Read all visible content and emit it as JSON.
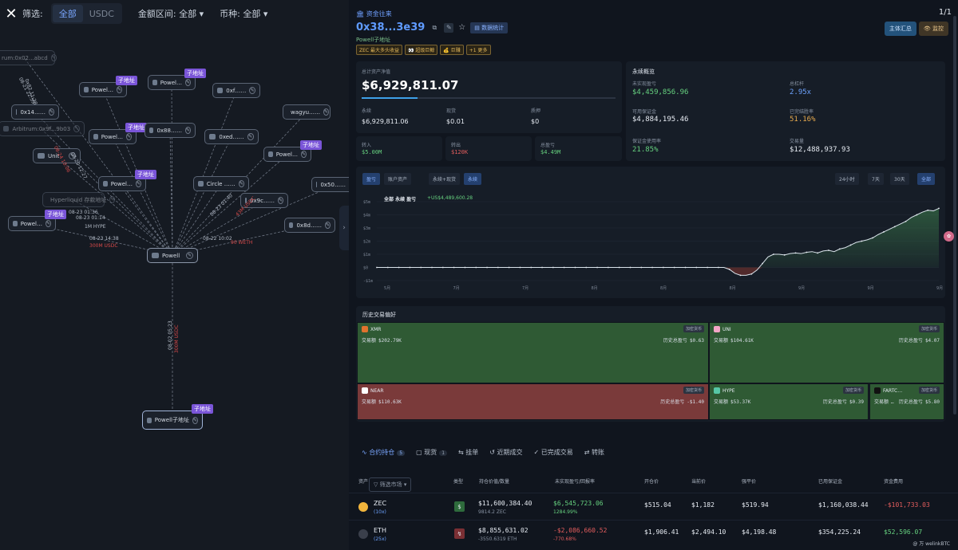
{
  "filterbar": {
    "filter_label": "筛选:",
    "seg_all": "全部",
    "seg_usdc": "USDC",
    "amount_label": "金额区间: 全部 ▾",
    "coin_label": "币种: 全部 ▾",
    "close": "✕"
  },
  "graph": {
    "nodes": [
      {
        "id": "n-arb-top",
        "label": "rum:0x02...abcd",
        "faint": true
      },
      {
        "id": "n-powell-a",
        "label": "Powel…"
      },
      {
        "id": "n-powell-b",
        "label": "Powel…"
      },
      {
        "id": "n-0xf",
        "label": "0xf……"
      },
      {
        "id": "n-0x14",
        "label": "0x14……"
      },
      {
        "id": "n-wagyu",
        "label": "wagyu……"
      },
      {
        "id": "n-arbitrum",
        "label": "Arbitrum:0x9f...9b03",
        "faint": true
      },
      {
        "id": "n-powell-c",
        "label": "Powel…"
      },
      {
        "id": "n-0x88",
        "label": "0x88……"
      },
      {
        "id": "n-0xed",
        "label": "0xed……"
      },
      {
        "id": "n-powell-d",
        "label": "Powel…"
      },
      {
        "id": "n-unit",
        "label": "Unit"
      },
      {
        "id": "n-powell-e",
        "label": "Powel…"
      },
      {
        "id": "n-circle",
        "label": "Circle ……"
      },
      {
        "id": "n-0x50",
        "label": "0x50……"
      },
      {
        "id": "n-hyperliquid",
        "label": "Hyperliquid 存款地址",
        "faint": true
      },
      {
        "id": "n-0x9c",
        "label": "0x9c……"
      },
      {
        "id": "n-powell-f",
        "label": "Powel…"
      },
      {
        "id": "n-0x8d",
        "label": "0x8d……"
      },
      {
        "id": "n-powell-center",
        "label": "Powell"
      },
      {
        "id": "n-powell-sub",
        "label": "Powell子地址"
      }
    ],
    "subaddr_tag": "子地址",
    "edge_labels": [
      {
        "t": "08-21 22:59",
        "red": false
      },
      {
        "t": "0x82 11:28",
        "red": false
      },
      {
        "t": "08-24 10:06",
        "red": true
      },
      {
        "t": "08-20 12:27",
        "red": false
      },
      {
        "t": "08-23 01:36",
        "red": false
      },
      {
        "t": "08-23 01:14",
        "red": false
      },
      {
        "t": "1M HYPE",
        "red": false
      },
      {
        "t": "08-23 14:38",
        "red": false
      },
      {
        "t": "300M USDC",
        "red": true
      },
      {
        "t": "08-22 10:02",
        "red": false
      },
      {
        "t": "90 WETH",
        "red": true
      },
      {
        "t": "08-23 01:40",
        "red": false
      },
      {
        "t": "43M USDC",
        "red": true
      },
      {
        "t": "08-02 05:23",
        "red": false
      },
      {
        "t": "300M USDC",
        "red": true
      }
    ],
    "collapse": "›"
  },
  "header": {
    "breadcrumb": "🏛 资金往来",
    "address": "0x38...3e39",
    "copy_icon": "⧉",
    "edit_icon": "✎",
    "star": "☆",
    "stats_btn": "▤ 数据统计",
    "subname": "Powell子地址",
    "tags": [
      "ZEC 最大多头收益",
      "👀 超级巨鲸",
      "💰 巨赚",
      "+1 更多"
    ],
    "pager": "1/1",
    "btn_summary": "主体汇总",
    "btn_monitor": "👁 监控"
  },
  "balance": {
    "label": "总计资产净值",
    "value": "$6,929,811.07",
    "perp_label": "永续",
    "perp_value": "$6,929,811.06",
    "spot_label": "现货",
    "spot_value": "$0.01",
    "stake_label": "质押",
    "stake_value": "$0",
    "in_label": "转入",
    "in_value": "$5.00M",
    "out_label": "转出",
    "out_value": "$120K",
    "total_label": "总盈亏",
    "total_value": "$4.49M",
    "bar_fraction": 0.22
  },
  "perp": {
    "title": "永续概览",
    "upnl_label": "未实现盈亏",
    "upnl_value": "$4,459,856.96",
    "lev_label": "总杠杆",
    "lev_value": "2.95x",
    "margin_label": "可用保证金",
    "margin_value": "$4,884,195.46",
    "winrate_label": "已完结胜率",
    "winrate_value": "51.16%",
    "usage_label": "保证金使用率",
    "usage_value": "21.85%",
    "volume_label": "交易量",
    "volume_value": "$12,488,937.93"
  },
  "chart_toolbar": {
    "tab_pnl": "盈亏",
    "tab_account": "账户资产",
    "tab_perp_spot": "永续+现货",
    "tab_perp": "永续",
    "range_24h": "24小时",
    "range_7d": "7天",
    "range_30d": "30天",
    "range_all": "全部"
  },
  "chart_data": {
    "type": "area",
    "title": "全部 永续 盈亏",
    "value_label": "+US$4,489,600.28",
    "yticks": [
      "$5m",
      "$4m",
      "$3m",
      "$2m",
      "$1m",
      "$0",
      "-$1m"
    ],
    "xticks": [
      "5月",
      "7月",
      "7月",
      "8月",
      "8月",
      "8月",
      "9月",
      "9月",
      "9月"
    ],
    "y": [
      0,
      0,
      0,
      0,
      0,
      0,
      0,
      0,
      0,
      0,
      0,
      0,
      0,
      0,
      0,
      0,
      0,
      0,
      0,
      0,
      0,
      0,
      0,
      0,
      0,
      0,
      0,
      0,
      0,
      0,
      0,
      0,
      0,
      0,
      0,
      0,
      0,
      0,
      0,
      0,
      0,
      0,
      0,
      0,
      0,
      0,
      0,
      0,
      0,
      0,
      0,
      0,
      0,
      0,
      0,
      0,
      0,
      0,
      0,
      0,
      0,
      0,
      0,
      0,
      -0.15,
      -0.45,
      -0.6,
      -0.6,
      -0.5,
      -0.2,
      0.3,
      0.8,
      1.0,
      1.0,
      0.95,
      1.05,
      1.1,
      1.05,
      1.15,
      1.2,
      1.1,
      1.25,
      1.3,
      1.2,
      1.4,
      1.5,
      1.7,
      1.9,
      2.0,
      2.1,
      2.25,
      2.5,
      2.7,
      2.9,
      3.1,
      3.3,
      3.5,
      3.8,
      4.0,
      4.2,
      4.35,
      4.3,
      4.49
    ],
    "ylim": [
      -1,
      5
    ]
  },
  "treemap": {
    "title": "历史交易偏好",
    "category": "加密货币",
    "vol_label": "交易额",
    "pnl_label": "历史总盈亏",
    "tiles": [
      {
        "id": "xmr",
        "name": "XMR",
        "volume": "$202.79K",
        "pnl": "$0.63",
        "color": "#2f5a34",
        "logo": "#e0732e"
      },
      {
        "id": "uni",
        "name": "UNI",
        "volume": "$104.61K",
        "pnl": "$4.07",
        "color": "#2f5a34",
        "logo": "#f3a6c6"
      },
      {
        "id": "near",
        "name": "NEAR",
        "volume": "$110.63K",
        "pnl": "-$1.40",
        "color": "#7a3a3a",
        "logo": "#ffffff"
      },
      {
        "id": "hype",
        "name": "HYPE",
        "volume": "$53.37K",
        "pnl": "$0.39",
        "color": "#2f5a34",
        "logo": "#57c7a6"
      },
      {
        "id": "fartc",
        "name": "FARTC…",
        "volume": "…",
        "pnl": "$5.80",
        "color": "#2f5a34",
        "logo": "#111111"
      }
    ]
  },
  "tabs": {
    "positions": "合约持仓",
    "positions_count": "5",
    "spot": "现货",
    "spot_count": "1",
    "orders": "挂单",
    "recent": "近期成交",
    "done": "已完成交易",
    "transfer": "转账"
  },
  "table": {
    "headers": {
      "asset": "资产",
      "filter": "▽ 筛选市场 ▾",
      "type": "类型",
      "value": "持仓价值/数量",
      "upnl": "未实现盈亏/回报率",
      "entry": "开仓价",
      "mark": "当前价",
      "liq": "强平价",
      "margin": "已用保证金",
      "funding": "资金费用"
    },
    "rows": [
      {
        "coin": "ZEC",
        "lev": "(10x)",
        "type_icon": "$",
        "value": "$11,600,384.40",
        "qty": "9814.2 ZEC",
        "upnl": "$6,545,723.06",
        "roe": "1284.99%",
        "entry": "$515.04",
        "mark": "$1,182",
        "liq": "$519.94",
        "margin": "$1,160,038.44",
        "funding": "-$101,733.03",
        "pos": true,
        "coin_color": "#f2b53c",
        "type_color": "#2e6b3c"
      },
      {
        "coin": "ETH",
        "lev": "(25x)",
        "type_icon": "↯",
        "value": "$8,855,631.02",
        "qty": "-3550.6319 ETH",
        "upnl": "-$2,086,660.52",
        "roe": "-770.68%",
        "entry": "$1,906.41",
        "mark": "$2,494.10",
        "liq": "$4,198.48",
        "margin": "$354,225.24",
        "funding": "$52,596.07",
        "pos": false,
        "coin_color": "#3a3f4b",
        "type_color": "#7a2f34"
      }
    ]
  },
  "watermark": "@ 万 welinkBTC",
  "float_avatar": "✿",
  "colors": {
    "accent": "#5f9bff",
    "positive": "#66d17f",
    "negative": "#e35d5d"
  }
}
